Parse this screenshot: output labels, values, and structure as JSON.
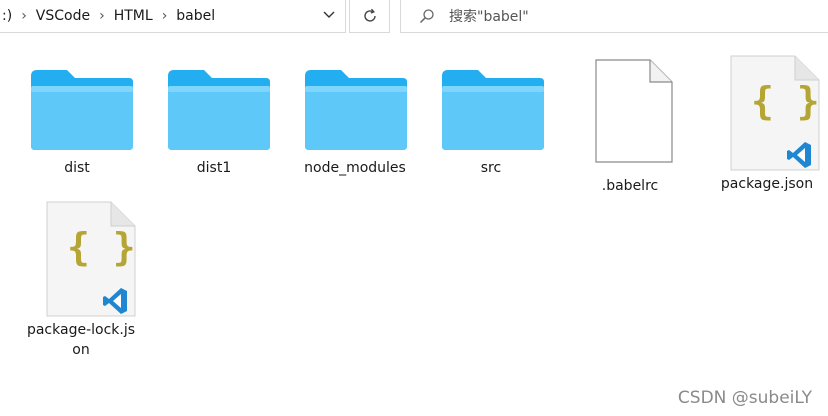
{
  "address": {
    "crumbs": [
      ":)",
      "VSCode",
      "HTML",
      "babel"
    ],
    "separator": "›"
  },
  "search": {
    "placeholder": "搜索\"babel\""
  },
  "files": [
    {
      "name": "dist",
      "type": "folder"
    },
    {
      "name": "dist1",
      "type": "folder"
    },
    {
      "name": "node_modules",
      "type": "folder"
    },
    {
      "name": "src",
      "type": "folder"
    },
    {
      "name": ".babelrc",
      "type": "blank-file"
    },
    {
      "name": "package.json",
      "type": "json-vscode-file"
    },
    {
      "name_line1": "package-lock.js",
      "name_line2": "on",
      "type": "json-vscode-file"
    }
  ],
  "watermark": "CSDN @subeiLY",
  "colors": {
    "folder": "#34b9f4",
    "json_braces": "#b5a535",
    "vscode": "#1f86d1"
  }
}
